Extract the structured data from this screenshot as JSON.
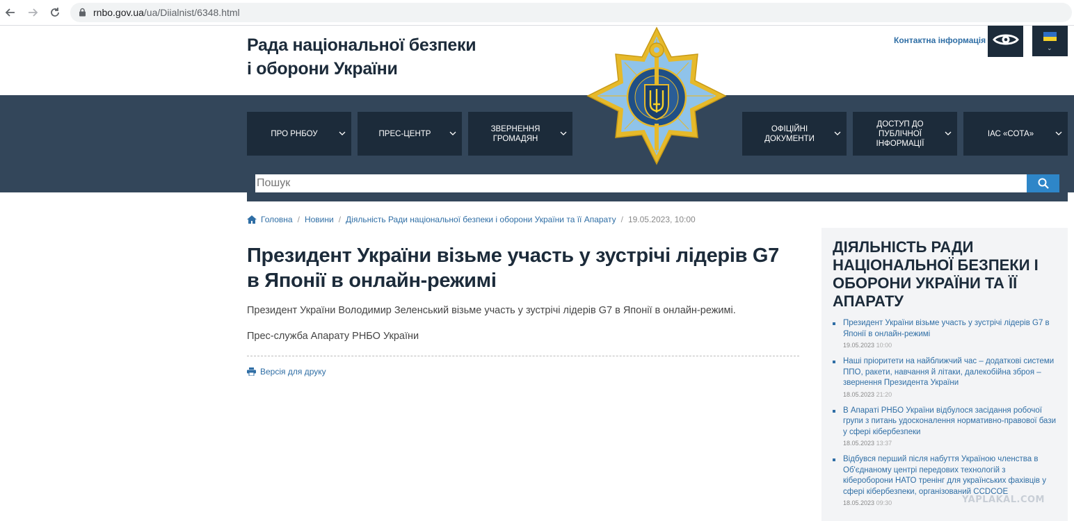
{
  "browser": {
    "url_host": "rnbo.gov.ua",
    "url_path": "/ua/Diialnist/6348.html"
  },
  "header": {
    "site_title_line1": "Рада національної безпеки",
    "site_title_line2": "і оборони України",
    "contact_link": "Контактна інформація",
    "accessibility_icon": "eye-icon",
    "language_icon": "ukraine-flag-icon"
  },
  "nav": {
    "items": [
      {
        "label": "Про РНБОУ"
      },
      {
        "label": "Прес-центр"
      },
      {
        "label": "Звернення громадян"
      },
      {
        "label": "Офіційні документи"
      },
      {
        "label": "Доступ до публічної інформації"
      },
      {
        "label": "ІАС «СОТА»"
      }
    ]
  },
  "search": {
    "placeholder": "Пошук"
  },
  "breadcrumb": {
    "home": "Головна",
    "news": "Новини",
    "section": "Діяльність Ради національної безпеки і оборони України та її Апарату",
    "date": "19.05.2023, 10:00"
  },
  "article": {
    "title": "Президент України візьме участь у зустрічі лідерів G7 в Японії в онлайн-режимі",
    "lead": "Президент України Володимир Зеленський візьме участь у зустрічі лідерів G7 в Японії в онлайн-режимі.",
    "signature": "Прес-служба Апарату РНБО України",
    "print_link": "Версія для друку"
  },
  "sidebar": {
    "title": "Діяльність Ради національної безпеки і оборони України та її Апарату",
    "items": [
      {
        "title": "Президент України візьме участь у зустрічі лідерів G7 в Японії в онлайн-режимі",
        "date": "19.05.2023",
        "time": "10:00"
      },
      {
        "title": "Наші пріоритети на найближчий час – додаткові системи ППО, ракети, навчання й літаки, далекобійна зброя – звернення Президента України",
        "date": "18.05.2023",
        "time": "21:20"
      },
      {
        "title": "В Апараті РНБО України відбулося засідання робочої групи з питань удосконалення нормативно-правової бази у сфері кібербезпеки",
        "date": "18.05.2023",
        "time": "13:37"
      },
      {
        "title": "Відбувся перший після набуття Україною членства в Об'єднаному центрі передових технологій з кібероборони НАТО тренінг для українських фахівців у сфері кібербезпеки, організований CCDCOE",
        "date": "18.05.2023",
        "time": "09:30"
      }
    ]
  },
  "watermark": "YAPLAKAL.COM",
  "colors": {
    "dark_navy": "#1c2b3a",
    "band_blue": "#33465a",
    "link_blue": "#2f6ea5",
    "search_button": "#2e86c8"
  }
}
